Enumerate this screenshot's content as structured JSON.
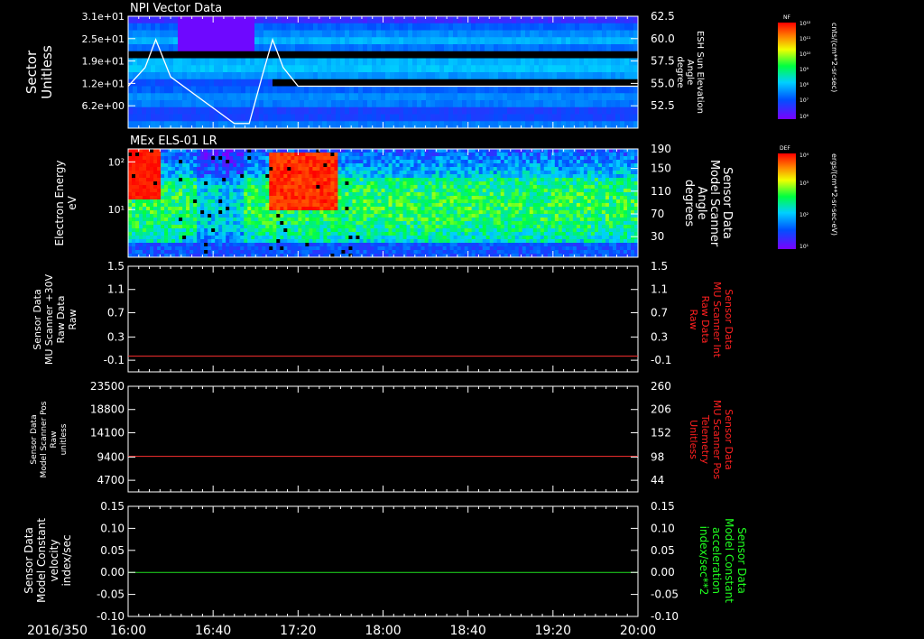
{
  "date_label": "2016/350",
  "time_ticks": [
    "16:00",
    "16:40",
    "17:20",
    "18:00",
    "18:40",
    "19:20",
    "20:00"
  ],
  "colorbars": [
    {
      "tag": "NF",
      "unit": "cnts/(cm**2-sr-sec)",
      "top_label": "10¹²",
      "mid_labels": [
        "10¹¹",
        "10¹⁰",
        "10⁹",
        "10⁸",
        "10⁷"
      ],
      "bottom_label": "10⁶"
    },
    {
      "tag": "DEF",
      "unit": "ergs/(cm**2-sr-sec-eV)",
      "top_label": "10⁴",
      "mid_labels": [
        "10³",
        "10²"
      ],
      "bottom_label": "10¹"
    }
  ],
  "chart_data": [
    {
      "type": "heatmap",
      "title": "NPI Vector Data",
      "ylabel": [
        "Sector",
        "Unitless"
      ],
      "y_ticks": [
        "3.1e+01",
        "2.5e+01",
        "1.9e+01",
        "1.2e+01",
        "6.2e+00"
      ],
      "ylabel_right": [
        "ESH Sun Elevation",
        "Angle",
        "degree"
      ],
      "y_right_ticks": [
        "62.5",
        "60.0",
        "57.5",
        "55.0",
        "52.5"
      ],
      "ylim_right": [
        50.5,
        62.5
      ],
      "overlay_series": {
        "name": "ESH Sun Elevation Angle",
        "color": "#ffffff",
        "x": [
          "16:00",
          "16:08",
          "16:13",
          "16:20",
          "16:50",
          "16:57",
          "17:03",
          "17:08",
          "17:13",
          "17:20",
          "20:00"
        ],
        "y": [
          55.0,
          57.0,
          60.0,
          56.0,
          51.0,
          51.0,
          56.0,
          60.0,
          57.0,
          55.0,
          55.0
        ]
      }
    },
    {
      "type": "heatmap",
      "title": "MEx ELS-01 LR",
      "ylabel": [
        "Electron Energy",
        "eV"
      ],
      "y_ticks": [
        "10²",
        "10¹"
      ],
      "ylabel_right": [
        "Sensor Data",
        "Model Scanner",
        "Angle",
        "degrees"
      ],
      "y_right_ticks": [
        "190",
        "150",
        "110",
        "70",
        "30"
      ]
    },
    {
      "type": "line",
      "ylabel": [
        "Sensor Data",
        "MU Scanner +30V",
        "Raw Data",
        "Raw"
      ],
      "y_ticks": [
        "1.5",
        "1.1",
        "0.7",
        "0.3",
        "-0.1"
      ],
      "y_right_ticks": [
        "1.5",
        "1.1",
        "0.7",
        "0.3",
        "-0.1"
      ],
      "ylim": [
        -0.3,
        1.5
      ],
      "ylabel_right": [
        "Sensor Data",
        "MU Scanner Int",
        "Raw Data",
        "Raw"
      ],
      "right_color": "#ff2020",
      "series": [
        {
          "color": "#ff3030",
          "x": [
            "16:00",
            "20:00"
          ],
          "y": [
            -0.03,
            -0.03
          ]
        }
      ]
    },
    {
      "type": "line",
      "ylabel": [
        "Sensor Data",
        "Model Scanner Pos",
        "Raw",
        "unitless"
      ],
      "y_ticks": [
        "23500",
        "18800",
        "14100",
        "9400",
        "4700"
      ],
      "y_right_ticks": [
        "260",
        "206",
        "152",
        "98",
        "44"
      ],
      "ylim": [
        0,
        23500
      ],
      "ylabel_right": [
        "Sensor Data",
        "MU Scanner Pos",
        "Telemetry",
        "Unitless"
      ],
      "right_color": "#ff2020",
      "series": [
        {
          "color": "#ff3030",
          "x": [
            "16:00",
            "20:00"
          ],
          "y": [
            7900,
            7900
          ]
        }
      ]
    },
    {
      "type": "line",
      "ylabel": [
        "Sensor Data",
        "Model Constant",
        "velocity",
        "index/sec"
      ],
      "y_ticks": [
        "0.15",
        "0.10",
        "0.05",
        "0.00",
        "-0.05",
        "-0.10"
      ],
      "y_right_ticks": [
        "0.15",
        "0.10",
        "0.05",
        "0.00",
        "-0.05",
        "-0.10"
      ],
      "ylim": [
        -0.1,
        0.15
      ],
      "ylabel_right": [
        "Sensor Data",
        "Model Constant",
        "acceleration",
        "index/sec**2"
      ],
      "right_color": "#20ff20",
      "series": [
        {
          "color": "#20e020",
          "x": [
            "16:00",
            "20:00"
          ],
          "y": [
            0.0,
            0.0
          ]
        }
      ]
    }
  ]
}
